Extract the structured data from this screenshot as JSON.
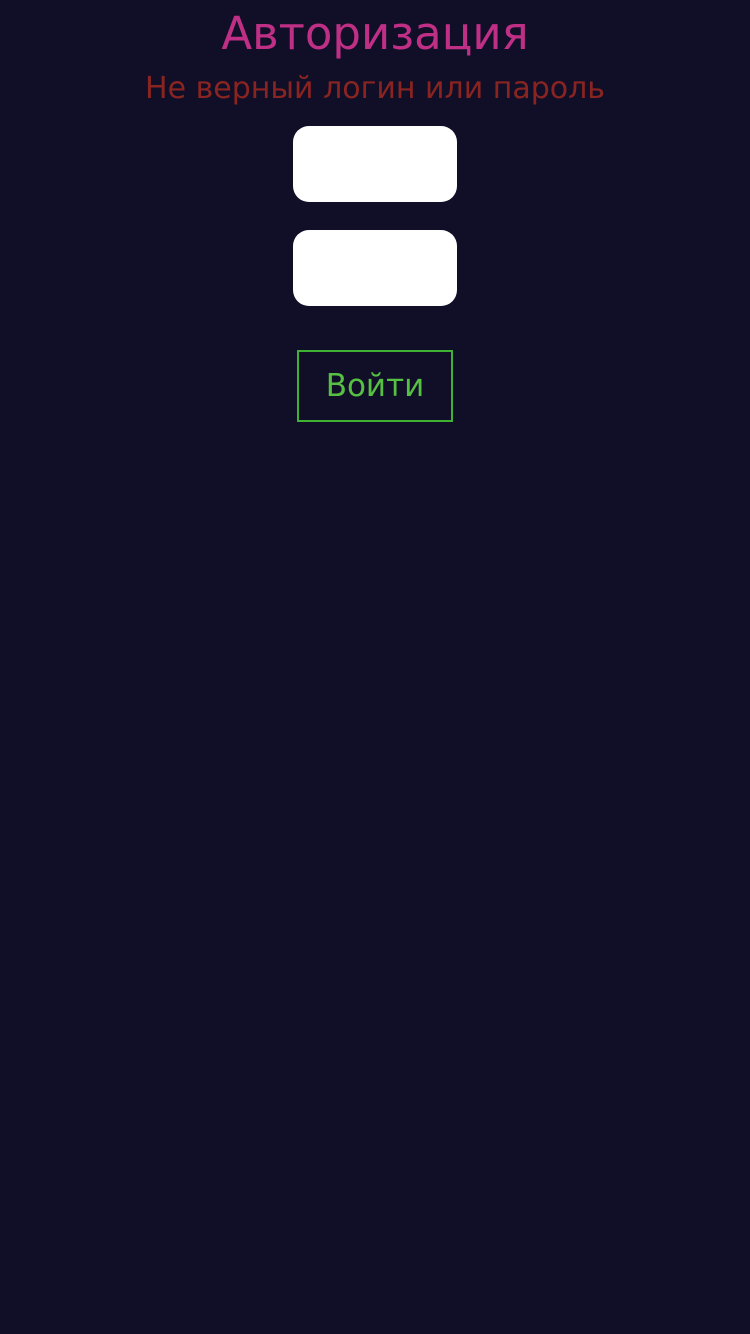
{
  "auth": {
    "title": "Авторизация",
    "error_message": "Не верный логин или пароль",
    "login_field": {
      "value": "",
      "placeholder": ""
    },
    "password_field": {
      "value": "",
      "placeholder": ""
    },
    "submit_label": "Войти"
  },
  "colors": {
    "background": "#100f27",
    "title": "#c02f86",
    "error": "#8a2421",
    "button_accent": "#3fb135"
  }
}
